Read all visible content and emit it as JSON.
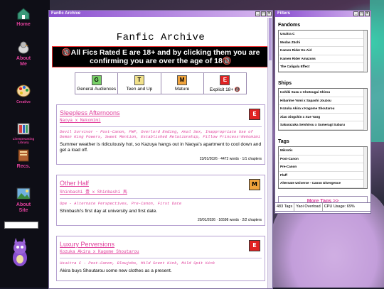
{
  "nav": {
    "items": [
      {
        "label": "Home",
        "icon": "home-icon",
        "color": "#3a9a7a"
      },
      {
        "label": "About\nMe",
        "icon": "bird-icon",
        "color": "#cfcfcf"
      },
      {
        "label": "Creative",
        "icon": "palette-icon",
        "color": "#f0a030"
      },
      {
        "label": "Livestreaming\nLibrary",
        "icon": "library-icon",
        "color": "#d04040"
      },
      {
        "label": "Recs.",
        "icon": "books-icon",
        "color": "#b06030"
      },
      {
        "label": "About\nSite",
        "icon": "landscape-icon",
        "color": "#70b0e0"
      }
    ]
  },
  "main_window": {
    "title": "Fanfic Archive",
    "heading": "Fanfic Archive",
    "banner": "🔞All Fics Rated E are 18+ and by clicking them you are confirming you are over the age of 18🔞",
    "ratings": [
      {
        "code": "G",
        "label": "General Audiences",
        "color": "#77d066"
      },
      {
        "code": "T",
        "label": "Teen and Up",
        "color": "#f1e18a"
      },
      {
        "code": "M",
        "label": "Mature",
        "color": "#f0a33c"
      },
      {
        "code": "E",
        "label": "Explicit 18+ 🔞",
        "color": "#e02222"
      }
    ],
    "fics": [
      {
        "title": "Sleepless Afternoons",
        "ship": "Naoya x Nekomimi",
        "tags": "Devil Survivor - Post-Canon, PWP, Overlord Ending, Anal Sex, Inappropriate Use of Demon King Powers, Sweet Mention, Established Relationship, Pillow Princess!Nekomimi",
        "summary": "Summer weather is ridiculously hot, so Kazuya hangs out in Naoya's apartment to cool down and get a load off.",
        "meta": "23/01/2026 · 4472 words · 1/1 chapters",
        "rating": "E",
        "rating_color": "#e02222"
      },
      {
        "title": "Other Half",
        "ship": "Shinbashi 豊 x Shinbashi 馬",
        "tags": "Ope - Alternate Perspectives, Pre-Canon, First Date",
        "summary": "Shinbashi's first day at university and first date.",
        "meta": "20/01/2026 · 16598 words · 2/2 chapters",
        "rating": "M",
        "rating_color": "#f0a33c"
      },
      {
        "title": "Luxury Perversions",
        "ship": "Kozuka Akira x Kagome Shoutarou",
        "tags": "Usuitra C - Post-Canon, Blowjobs, Mild Scent Kink, Mild Spit Kink",
        "summary": "Akira buys Shoutarou some new clothes as a present.",
        "meta": "",
        "rating": "E",
        "rating_color": "#e02222"
      }
    ]
  },
  "filters_window": {
    "title": "Filters",
    "fandoms_title": "Fandoms",
    "fandoms": [
      "Usuitra C",
      "Modas Züchi",
      "Kamen Rider Ex-Aid",
      "Kamen Rider Amazons",
      "The Caligula Effect"
    ],
    "ships_title": "Ships",
    "ships": [
      "Isshiki Suzu x Chotougai Shirou",
      "Hibarime Yomi x Sapashi Jouzou",
      "Kozuka Akira x Kagome Shoutarou",
      "Xiao Xingchin x Xue Yang",
      "Sakurazuka Seishirou x Sumeragi Subaru"
    ],
    "tags_title": "Tags",
    "tags": [
      "Mikrotic",
      "Post-Canon",
      "Pre-Canon",
      "Fluff",
      "Alternate Universe - Canon Divergence"
    ],
    "more_tags": "More Tags >>"
  },
  "status": {
    "tag_count": "483 Tags",
    "overload": "Yaoi Overload",
    "cpu": "CPU Usage: 69%"
  },
  "colors": {
    "accent": "#e0409c",
    "titlebar_start": "#8a4fd0",
    "titlebar_end": "#d7b7ef"
  }
}
